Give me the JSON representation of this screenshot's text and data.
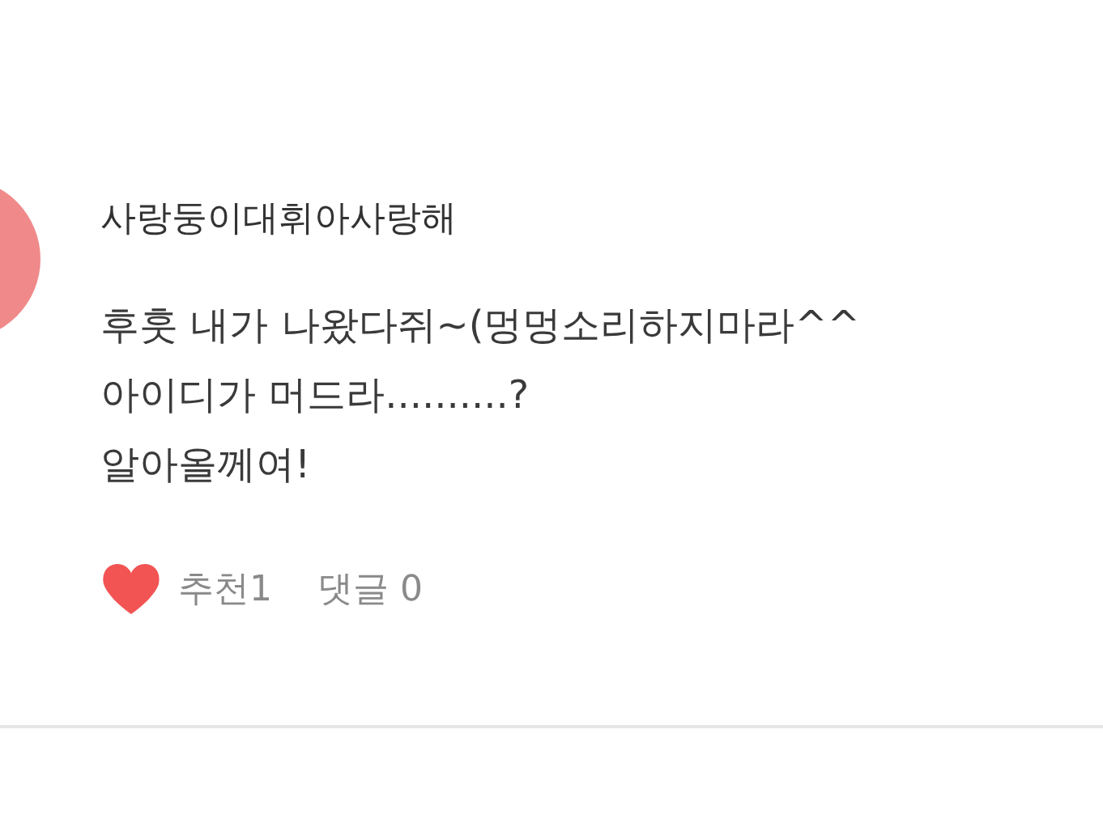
{
  "comment": {
    "author": "사랑둥이대휘아사랑해",
    "lines": [
      "후훗 내가 나왔다쥐~(멍멍소리하지마라^^",
      "아이디가 머드라..........?",
      "알아올께여!"
    ],
    "liked": true,
    "likes_label": "추천1",
    "replies_label": "댓글 0"
  }
}
